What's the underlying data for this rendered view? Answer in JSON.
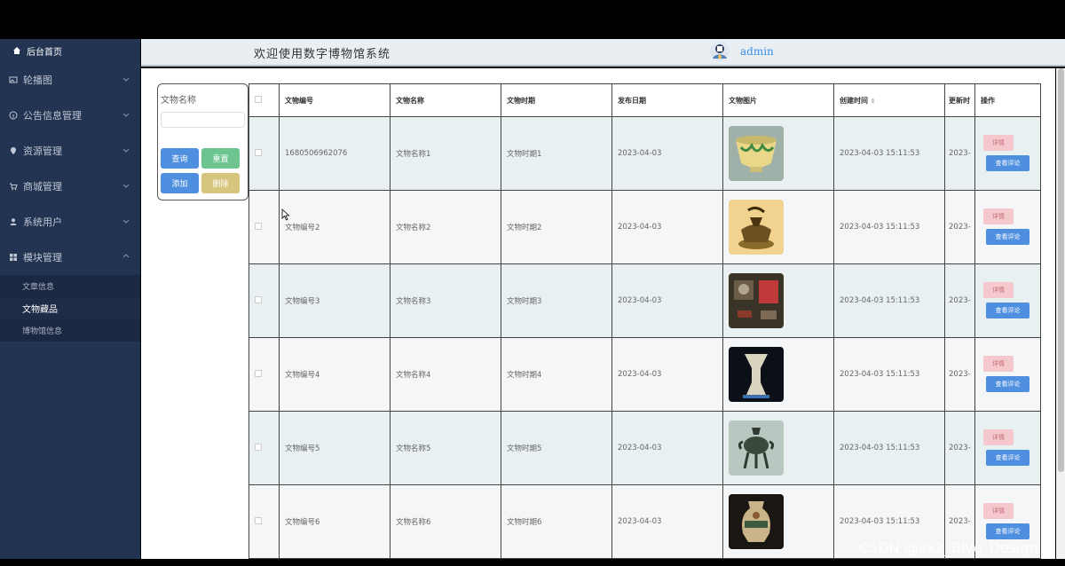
{
  "sidebar": {
    "home_label": "后台首页",
    "menu": [
      {
        "label": "轮播图",
        "icon": "image-icon"
      },
      {
        "label": "公告信息管理",
        "icon": "info-icon"
      },
      {
        "label": "资源管理",
        "icon": "location-icon"
      },
      {
        "label": "商城管理",
        "icon": "cart-icon"
      },
      {
        "label": "系统用户",
        "icon": "user-icon"
      },
      {
        "label": "模块管理",
        "icon": "grid-icon"
      }
    ],
    "submenu": [
      "文章信息",
      "文物藏品",
      "博物馆信息"
    ]
  },
  "header": {
    "title": "欢迎使用数字博物馆系统",
    "username": "admin"
  },
  "search": {
    "label": "文物名称",
    "placeholder": "",
    "query_label": "查询",
    "reset_label": "重置",
    "add_label": "添加",
    "delete_label": "删除"
  },
  "table": {
    "headers": [
      "文物编号",
      "文物名称",
      "文物时期",
      "发布日期",
      "文物图片",
      "创建时间",
      "更新时",
      "操作"
    ],
    "detail_label": "详情",
    "comment_label": "查看评论",
    "rows": [
      {
        "code": "1680506962076",
        "name": "文物名称1",
        "period": "文物时期1",
        "date": "2023-04-03",
        "created": "2023-04-03 15:11:53",
        "updated": "2023-",
        "img": "bowl"
      },
      {
        "code": "文物编号2",
        "name": "文物名称2",
        "period": "文物时期2",
        "date": "2023-04-03",
        "created": "2023-04-03 15:11:53",
        "updated": "2023-",
        "img": "censer"
      },
      {
        "code": "文物编号3",
        "name": "文物名称3",
        "period": "文物时期3",
        "date": "2023-04-03",
        "created": "2023-04-03 15:11:53",
        "updated": "2023-",
        "img": "display"
      },
      {
        "code": "文物编号4",
        "name": "文物名称4",
        "period": "文物时期4",
        "date": "2023-04-03",
        "created": "2023-04-03 15:11:53",
        "updated": "2023-",
        "img": "vase"
      },
      {
        "code": "文物编号5",
        "name": "文物名称5",
        "period": "文物时期5",
        "date": "2023-04-03",
        "created": "2023-04-03 15:11:53",
        "updated": "2023-",
        "img": "incense"
      },
      {
        "code": "文物编号6",
        "name": "文物名称6",
        "period": "文物时期6",
        "date": "2023-04-03",
        "created": "2023-04-03 15:11:53",
        "updated": "2023-",
        "img": "jar"
      }
    ]
  },
  "watermark": "CSDN @vx2_Biye_Design",
  "colors": {
    "sidebar_bg": "#233352",
    "primary": "#4f8fdf",
    "success": "#6cc58f",
    "warning": "#d6c57d",
    "danger_light": "#f4c8cc"
  }
}
